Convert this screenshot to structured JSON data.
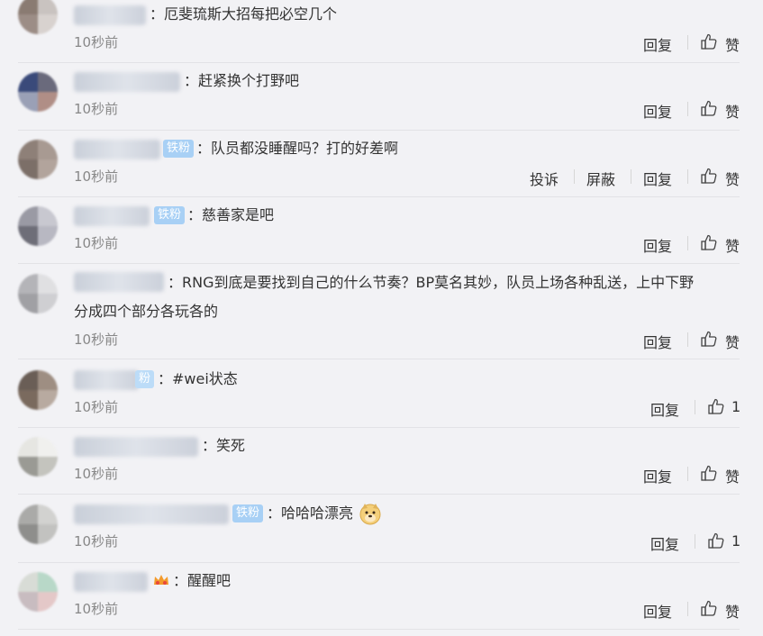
{
  "comments": [
    {
      "text": "：厄斐琉斯大招每把必空几个",
      "time": "10秒前",
      "reply": "回复",
      "like": "赞"
    },
    {
      "text": "：赶紧换个打野吧",
      "time": "10秒前",
      "reply": "回复",
      "like": "赞"
    },
    {
      "badge": "铁粉",
      "text": "：队员都没睡醒吗？打的好差啊",
      "time": "10秒前",
      "report": "投诉",
      "block": "屏蔽",
      "reply": "回复",
      "like": "赞"
    },
    {
      "badge": "铁粉",
      "text": "：慈善家是吧",
      "time": "10秒前",
      "reply": "回复",
      "like": "赞"
    },
    {
      "text": "：RNG到底是要找到自己的什么节奏？BP莫名其妙，队员上场各种乱送，上中下野",
      "text2": "分成四个部分各玩各的",
      "time": "10秒前",
      "reply": "回复",
      "like": "赞"
    },
    {
      "badge": "粉",
      "text": "：#wei状态",
      "time": "10秒前",
      "reply": "回复",
      "like": "1"
    },
    {
      "text": "：笑死",
      "time": "10秒前",
      "reply": "回复",
      "like": "赞"
    },
    {
      "badge": "铁粉",
      "text": "：哈哈哈漂亮",
      "time": "10秒前",
      "reply": "回复",
      "like": "1"
    },
    {
      "text": "：醒醒吧",
      "time": "10秒前",
      "reply": "回复",
      "like": "赞"
    }
  ],
  "icons": {
    "like": "thumbs-up-icon",
    "emoji": "doge-emoji-icon",
    "vip": "vip-crown-icon"
  },
  "colors": {
    "badge": "#a8d0f5",
    "time": "#888888",
    "text": "#333333",
    "background": "#f2f2f5"
  }
}
